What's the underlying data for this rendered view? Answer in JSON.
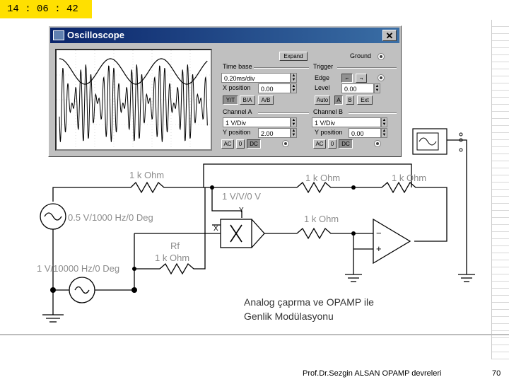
{
  "timer": "14 : 06 : 42",
  "window": {
    "title": "Oscilloscope"
  },
  "controls": {
    "expand": "Expand",
    "ground": "Ground",
    "time_base": {
      "title": "Time base",
      "value": "0.20ms/div",
      "xpos_label": "X position",
      "xpos_value": "0.00",
      "yt": "Y/T",
      "ba": "B/A",
      "ab": "A/B"
    },
    "trigger": {
      "title": "Trigger",
      "edge": "Edge",
      "level": "Level",
      "level_value": "0.00",
      "auto": "Auto",
      "a": "A",
      "b": "B",
      "ext": "Ext"
    },
    "channel_a": {
      "title": "Channel A",
      "value": "1  V/Div",
      "ypos_label": "Y position",
      "ypos_value": "2.00",
      "ac": "AC",
      "zero": "0",
      "dc": "DC"
    },
    "channel_b": {
      "title": "Channel B",
      "value": "1  V/Div",
      "ypos_label": "Y position",
      "ypos_value": "0.00",
      "ac": "AC",
      "zero": "0",
      "dc": "DC"
    }
  },
  "circuit": {
    "r1": "1 k Ohm",
    "r2": "1 k Ohm",
    "r3": "1 k Ohm",
    "r4": "1 k Ohm",
    "multiplier": "1 V/V/0 V",
    "mult_y": "Y",
    "mult_x": "X",
    "mult_symbol": "X",
    "source1": "0.5 V/1000 Hz/0 Deg",
    "source2": "1 V/10000 Hz/0 Deg",
    "rf_name": "Rf",
    "rf_value": "1 k Ohm",
    "opamp_minus": "−",
    "opamp_plus": "+"
  },
  "description": {
    "line1": "Analog çaprma ve OPAMP ile",
    "line2": "Genlik Modülasyonu"
  },
  "footer": {
    "author": "Prof.Dr.Sezgin ALSAN  OPAMP devreleri",
    "page": "70"
  }
}
